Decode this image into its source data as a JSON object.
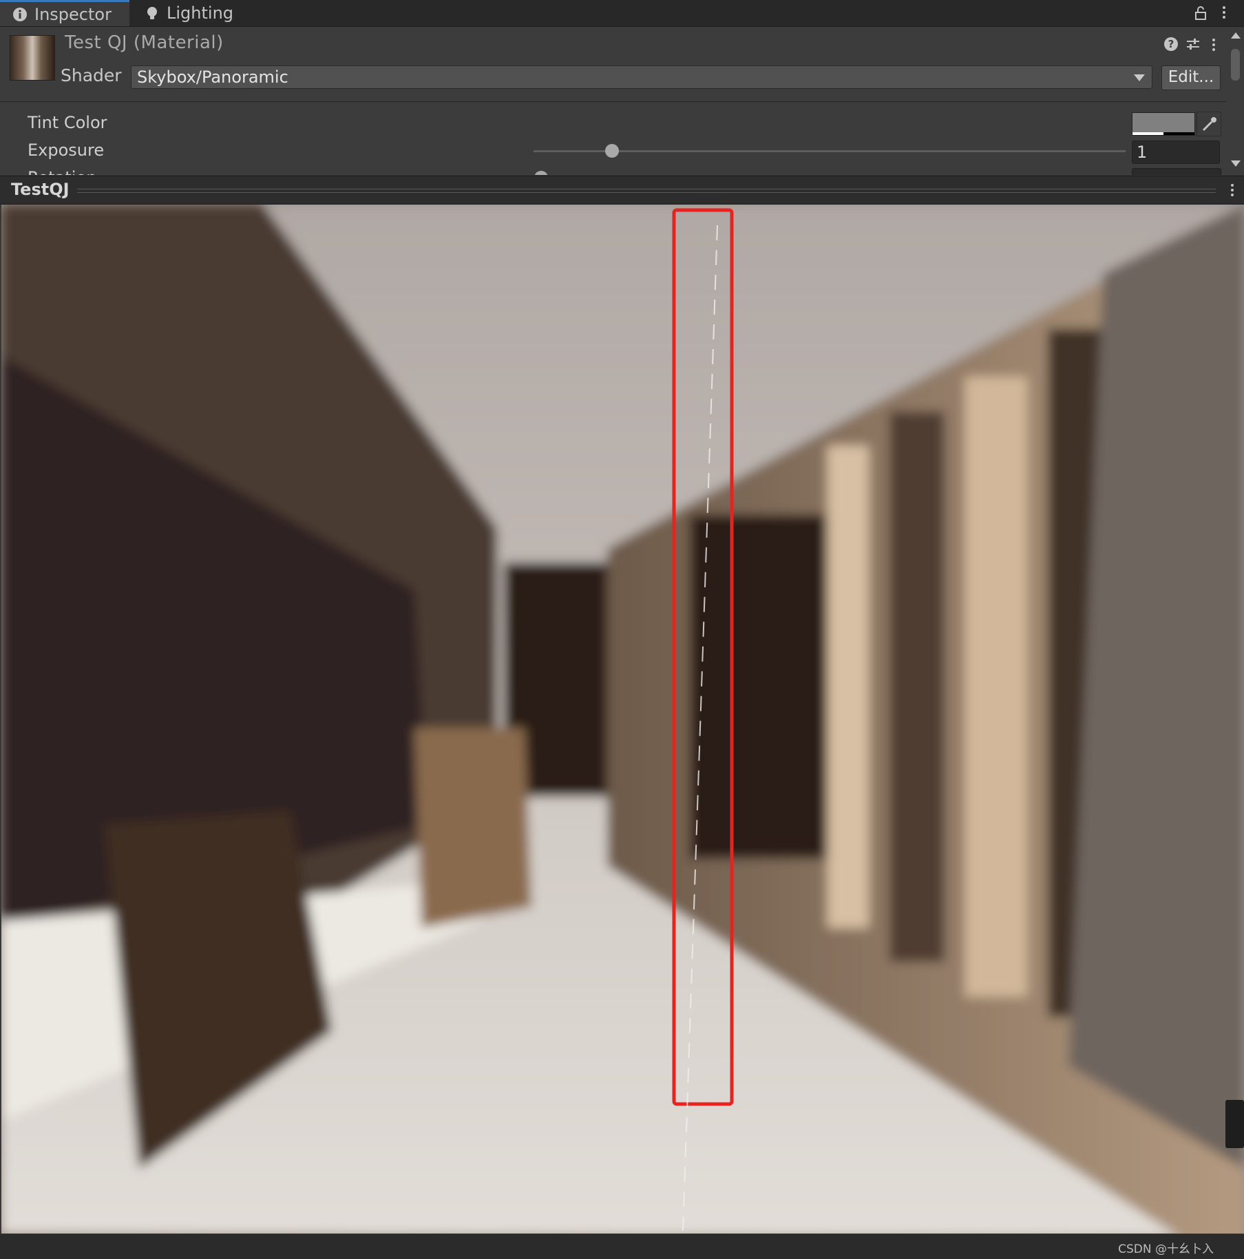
{
  "tabs": [
    {
      "label": "Inspector",
      "icon": "info-icon",
      "active": true
    },
    {
      "label": "Lighting",
      "icon": "lightbulb-icon",
      "active": false
    }
  ],
  "material": {
    "title": "Test QJ (Material)",
    "shader_label": "Shader",
    "shader_value": "Skybox/Panoramic",
    "edit_label": "Edit..."
  },
  "properties": {
    "tint_label": "Tint Color",
    "tint_color": "#808080",
    "exposure_label": "Exposure",
    "exposure_value": "1",
    "exposure_slider_fraction": 0.13,
    "rotation_label": "Rotation"
  },
  "preview": {
    "title": "TestQJ",
    "highlight_color": "#e8221e"
  },
  "watermark": "CSDN @十幺卜入",
  "colors": {
    "accent": "#3a79bb",
    "panel": "#3c3c3c",
    "dark": "#282828"
  }
}
